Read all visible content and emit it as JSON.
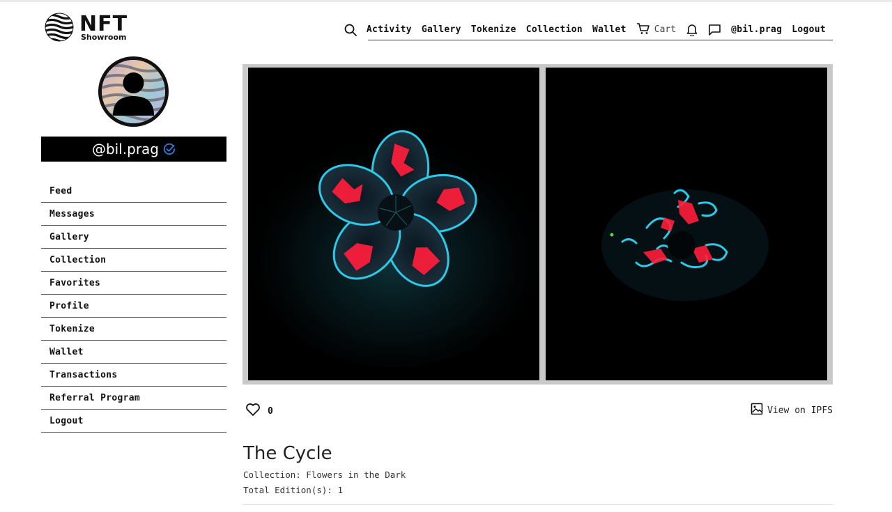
{
  "brand": {
    "name": "NFT",
    "subtitle": "Showroom"
  },
  "topnav": {
    "search_icon": "search-icon",
    "items": [
      "Activity",
      "Gallery",
      "Tokenize",
      "Collection",
      "Wallet"
    ],
    "cart_label": "Cart",
    "user_handle": "@bil.prag",
    "logout_label": "Logout"
  },
  "profile": {
    "handle": "@bil.prag",
    "verified": true
  },
  "sidebar": {
    "items": [
      {
        "label": "Feed"
      },
      {
        "label": "Messages"
      },
      {
        "label": "Gallery"
      },
      {
        "label": "Collection"
      },
      {
        "label": "Favorites"
      },
      {
        "label": "Profile"
      },
      {
        "label": "Tokenize"
      },
      {
        "label": "Wallet"
      },
      {
        "label": "Transactions"
      },
      {
        "label": "Referral Program"
      },
      {
        "label": "Logout"
      }
    ]
  },
  "artwork": {
    "likes": "0",
    "ipfs_label": "View on IPFS",
    "title": "The Cycle",
    "collection": "Collection: Flowers in the Dark",
    "editions": "Total Edition(s): 1"
  },
  "colors": {
    "accent_verified": "#2f7de1",
    "petal_glow": "#2ec8e8",
    "petal_red": "#ff1e3c"
  }
}
